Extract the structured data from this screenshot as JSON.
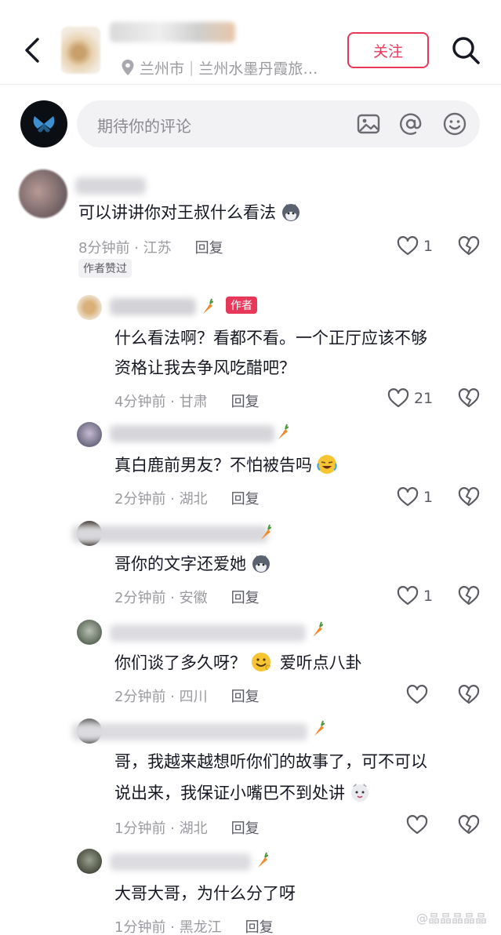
{
  "header": {
    "location_city": "兰州市",
    "location_place": "兰州水墨丹霞旅…",
    "follow_label": "关注"
  },
  "composer": {
    "placeholder": "期待你的评论"
  },
  "comments": [
    {
      "text_lines": [
        "可以讲讲你对王叔什么看法"
      ],
      "time": "8分钟前 · 江苏",
      "reply_label": "回复",
      "likes": "1",
      "author_liked_label": "作者赞过"
    },
    {
      "is_author": true,
      "author_badge": "作者",
      "text_lines": [
        "什么看法啊？看都不看。一个正厅应该不够",
        "资格让我去争风吃醋吧？"
      ],
      "time": "4分钟前 · 甘肃",
      "reply_label": "回复",
      "likes": "21"
    },
    {
      "text_lines": [
        "真白鹿前男友？不怕被告吗"
      ],
      "time": "2分钟前 · 湖北",
      "reply_label": "回复",
      "likes": "1"
    },
    {
      "text_lines": [
        "哥你的文字还爱她"
      ],
      "time": "2分钟前 · 安徽",
      "reply_label": "回复",
      "likes": "1"
    },
    {
      "text_lines": [
        "你们谈了多久呀？"
      ],
      "text_after_emoji": "爱听点八卦",
      "time": "2分钟前 · 四川",
      "reply_label": "回复",
      "likes": ""
    },
    {
      "text_lines": [
        "哥，我越来越想听你们的故事了，可不可以",
        "说出来，我保证小嘴巴不到处讲"
      ],
      "time": "1分钟前 · 湖北",
      "reply_label": "回复",
      "likes": ""
    },
    {
      "text_lines": [
        "大哥大哥，为什么分了呀"
      ],
      "time": "1分钟前 · 黑龙江",
      "reply_label": "回复",
      "likes": ""
    }
  ],
  "watermark": "@晶晶晶晶晶"
}
